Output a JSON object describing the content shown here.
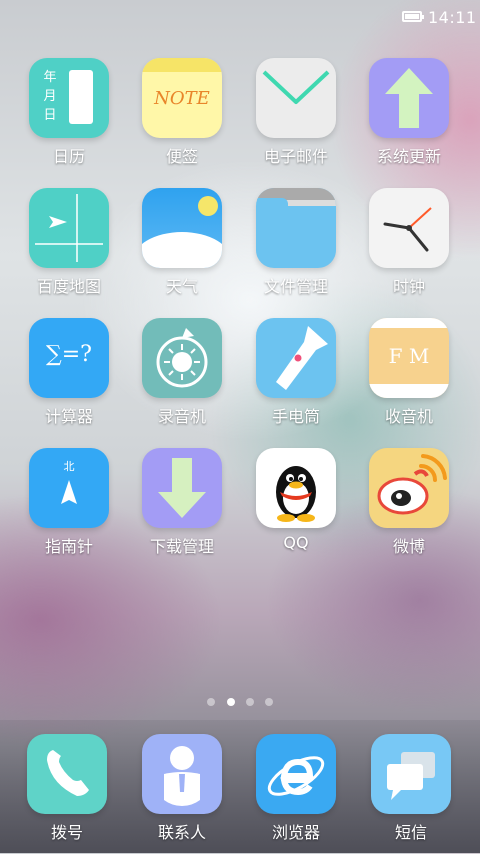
{
  "status_bar": {
    "time": "14:11",
    "battery_icon": "battery-full-icon"
  },
  "apps": [
    {
      "label": "日历",
      "icon": "calendar-icon",
      "color": "#4fd0c6",
      "glyphs": [
        "年",
        "月",
        "日"
      ]
    },
    {
      "label": "便签",
      "icon": "note-icon",
      "color": "#fff7a8",
      "glyphs": [
        "NOTE"
      ]
    },
    {
      "label": "电子邮件",
      "icon": "mail-icon",
      "color": "#eeeeee"
    },
    {
      "label": "系统更新",
      "icon": "update-arrow-icon",
      "color": "#a39cf5"
    },
    {
      "label": "百度地图",
      "icon": "map-icon",
      "color": "#4fd0c6"
    },
    {
      "label": "天气",
      "icon": "weather-icon",
      "color": "#3aa9f2"
    },
    {
      "label": "文件管理",
      "icon": "folder-icon",
      "color": "#6cc3f0"
    },
    {
      "label": "时钟",
      "icon": "clock-icon",
      "color": "#f2f2f2"
    },
    {
      "label": "计算器",
      "icon": "calculator-icon",
      "color": "#33a8f5",
      "glyphs": [
        "∑=?"
      ]
    },
    {
      "label": "录音机",
      "icon": "recorder-icon",
      "color": "#72bcb9"
    },
    {
      "label": "手电筒",
      "icon": "flashlight-icon",
      "color": "#6cc3f0"
    },
    {
      "label": "收音机",
      "icon": "radio-icon",
      "color": "#f7d28e",
      "glyphs": [
        "F M"
      ]
    },
    {
      "label": "指南针",
      "icon": "compass-icon",
      "color": "#33a8f5",
      "glyphs": [
        "北"
      ]
    },
    {
      "label": "下载管理",
      "icon": "download-icon",
      "color": "#a39cf5"
    },
    {
      "label": "QQ",
      "icon": "qq-penguin-icon",
      "color": "#ffffff"
    },
    {
      "label": "微博",
      "icon": "weibo-icon",
      "color": "#f5d680"
    }
  ],
  "page_indicator": {
    "count": 4,
    "active": 1
  },
  "dock": [
    {
      "label": "拨号",
      "icon": "phone-icon",
      "color": "#5fd3c8"
    },
    {
      "label": "联系人",
      "icon": "contacts-icon",
      "color": "#9fb2f7"
    },
    {
      "label": "浏览器",
      "icon": "browser-icon",
      "color": "#3aa9f2"
    },
    {
      "label": "短信",
      "icon": "message-icon",
      "color": "#78c8f5"
    }
  ]
}
